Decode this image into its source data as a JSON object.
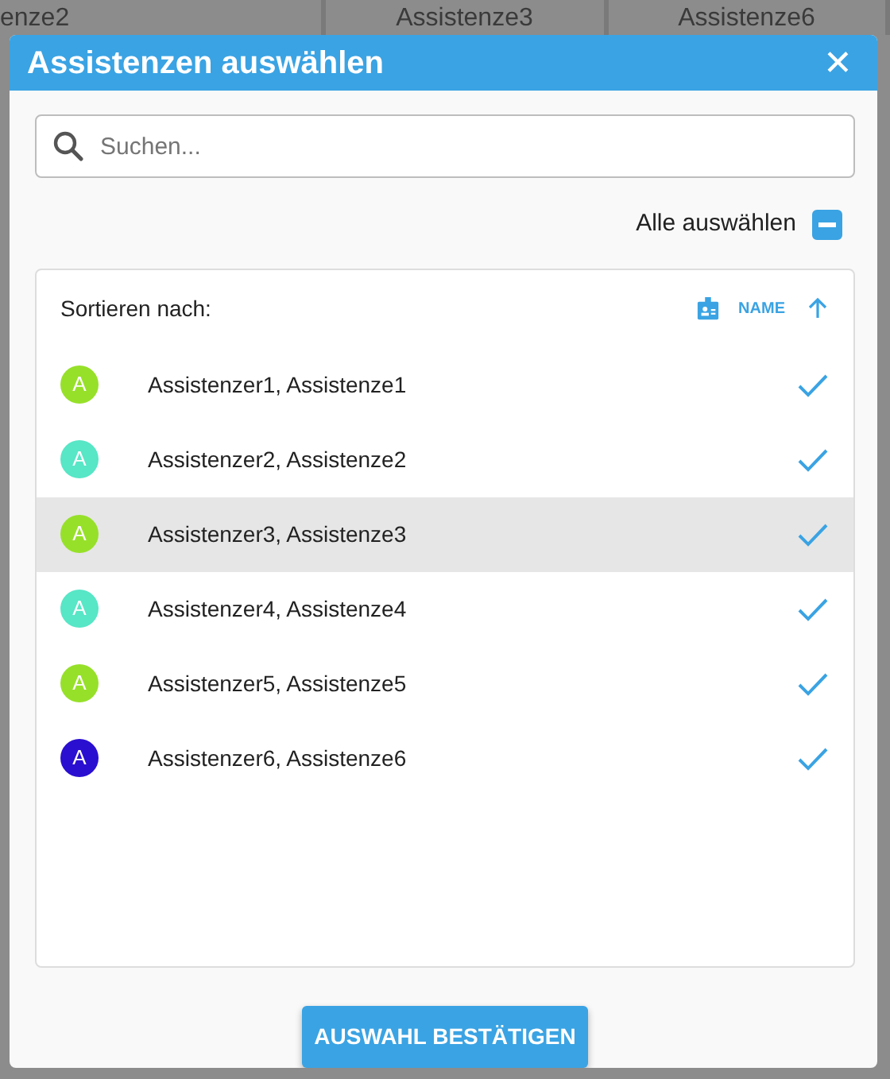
{
  "background": {
    "labels": [
      "enze2",
      "Assistenze3",
      "Assistenze6"
    ]
  },
  "dialog": {
    "title": "Assistenzen auswählen",
    "close": "✕"
  },
  "search": {
    "placeholder": "Suchen..."
  },
  "select_all": {
    "label": "Alle auswählen",
    "indeterminate": true
  },
  "sort": {
    "label": "Sortieren nach:",
    "field": "NAME"
  },
  "items": [
    {
      "initial": "A",
      "name": "Assistenzer1, Assistenze1",
      "color": "#97e02a",
      "checked": true,
      "highlighted": false
    },
    {
      "initial": "A",
      "name": "Assistenzer2, Assistenze2",
      "color": "#57e6c6",
      "checked": true,
      "highlighted": false
    },
    {
      "initial": "A",
      "name": "Assistenzer3, Assistenze3",
      "color": "#97e02a",
      "checked": true,
      "highlighted": true
    },
    {
      "initial": "A",
      "name": "Assistenzer4, Assistenze4",
      "color": "#57e6c6",
      "checked": true,
      "highlighted": false
    },
    {
      "initial": "A",
      "name": "Assistenzer5, Assistenze5",
      "color": "#97e02a",
      "checked": true,
      "highlighted": false
    },
    {
      "initial": "A",
      "name": "Assistenzer6, Assistenze6",
      "color": "#2a0fd0",
      "checked": true,
      "highlighted": false
    }
  ],
  "confirm_button": "AUSWAHL BESTÄTIGEN"
}
